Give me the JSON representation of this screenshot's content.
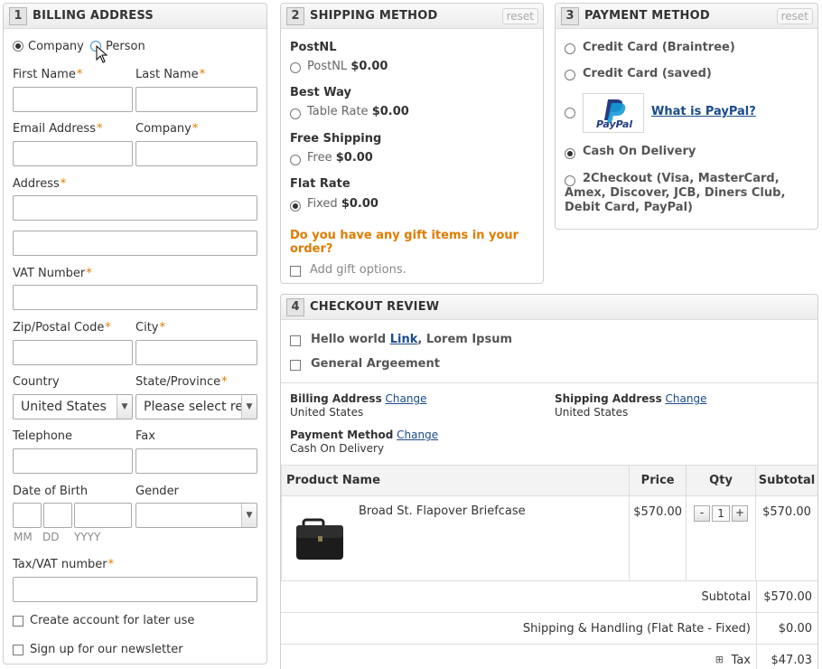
{
  "billing": {
    "num": "1",
    "title": "BILLING ADDRESS",
    "type_company": "Company",
    "type_person": "Person",
    "first_name": "First Name",
    "last_name": "Last Name",
    "email": "Email Address",
    "company": "Company",
    "address": "Address",
    "vat": "VAT Number",
    "zip": "Zip/Postal Code",
    "city": "City",
    "country": "Country",
    "country_value": "United States",
    "state": "State/Province",
    "state_value": "Please select re",
    "telephone": "Telephone",
    "fax": "Fax",
    "dob": "Date of Birth",
    "gender": "Gender",
    "dob_mm": "MM",
    "dob_dd": "DD",
    "dob_yyyy": "YYYY",
    "taxvat": "Tax/VAT number",
    "create_account": "Create account for later use",
    "newsletter": "Sign up for our newsletter",
    "required_mark": "*"
  },
  "shipping": {
    "num": "2",
    "title": "SHIPPING METHOD",
    "reset": "reset",
    "carriers": [
      {
        "name": "PostNL",
        "option": "PostNL",
        "price": "$0.00"
      },
      {
        "name": "Best Way",
        "option": "Table Rate",
        "price": "$0.00"
      },
      {
        "name": "Free Shipping",
        "option": "Free",
        "price": "$0.00"
      },
      {
        "name": "Flat Rate",
        "option": "Fixed",
        "price": "$0.00"
      }
    ],
    "gift_question": "Do you have any gift items in your order?",
    "gift_option": "Add gift options."
  },
  "payment": {
    "num": "3",
    "title": "PAYMENT METHOD",
    "reset": "reset",
    "options": [
      "Credit Card (Braintree)",
      "Credit Card (saved)",
      "Cash On Delivery",
      "2Checkout (Visa, MasterCard, Amex, Discover, JCB, Diners Club, Debit Card, PayPal)"
    ],
    "paypal_logo": "PayPal",
    "paypal_link": "What is PayPal?"
  },
  "review": {
    "num": "4",
    "title": "CHECKOUT REVIEW",
    "agreement1_prefix": "Hello world",
    "agreement1_link": "Link",
    "agreement1_suffix": ", Lorem Ipsum",
    "agreement2": "General Argeement",
    "billing_label": "Billing Address",
    "billing_value": "United States",
    "shipping_label": "Shipping Address",
    "shipping_value": "United States",
    "payment_label": "Payment Method",
    "payment_value": "Cash On Delivery",
    "change": "Change",
    "col_product": "Product Name",
    "col_price": "Price",
    "col_qty": "Qty",
    "col_subtotal": "Subtotal",
    "item_name": "Broad St. Flapover Briefcase",
    "item_price": "$570.00",
    "item_qty": "1",
    "item_subtotal": "$570.00",
    "qty_minus": "-",
    "qty_plus": "+",
    "subtotal_label": "Subtotal",
    "subtotal_value": "$570.00",
    "shipping_label_row": "Shipping & Handling (Flat Rate - Fixed)",
    "shipping_value_row": "$0.00",
    "tax_label": "Tax",
    "tax_value": "$47.03",
    "tax_expand": "⊞"
  },
  "colors": {
    "required": "#e07b00",
    "gift_question": "#e07b00",
    "link": "#1a4b8c"
  }
}
